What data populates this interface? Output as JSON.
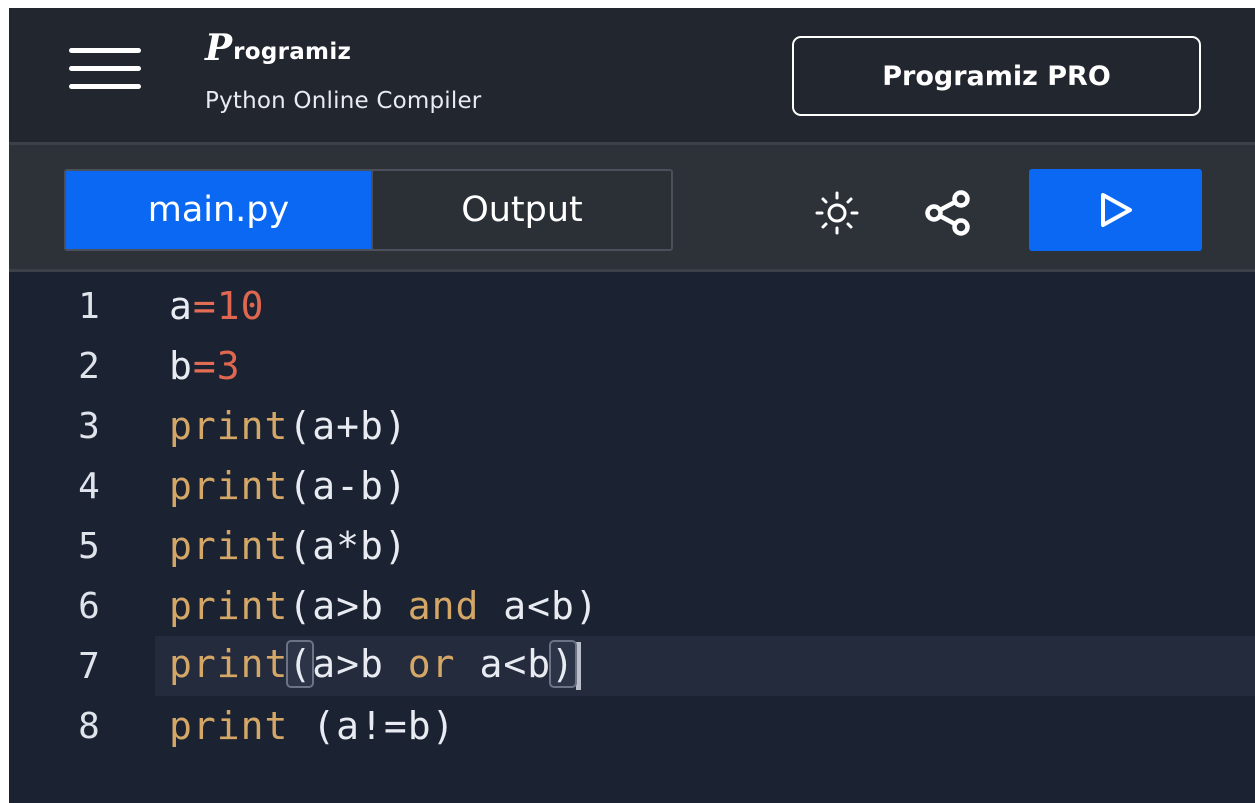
{
  "header": {
    "brand_mark": "P",
    "brand_name": "rogramiz",
    "subtitle": "Python Online Compiler",
    "pro_button_label": "Programiz PRO",
    "menu_icon": "hamburger-menu-icon"
  },
  "toolbar": {
    "tabs": [
      {
        "label": "main.py",
        "active": true
      },
      {
        "label": "Output",
        "active": false
      }
    ],
    "theme_icon": "sun-icon",
    "share_icon": "share-icon",
    "run_icon": "play-icon"
  },
  "editor": {
    "current_line": 7,
    "lines": [
      {
        "number": "1",
        "tokens": [
          "a",
          "=",
          "10"
        ]
      },
      {
        "number": "2",
        "tokens": [
          "b",
          "=",
          "3"
        ]
      },
      {
        "number": "3",
        "tokens": [
          "print",
          "(a+b)"
        ]
      },
      {
        "number": "4",
        "tokens": [
          "print",
          "(a-b)"
        ]
      },
      {
        "number": "5",
        "tokens": [
          "print",
          "(a*b)"
        ]
      },
      {
        "number": "6",
        "tokens": [
          "print",
          "(a>b ",
          "and",
          " a<b)"
        ]
      },
      {
        "number": "7",
        "tokens": [
          "print",
          "(",
          "a>b ",
          "or",
          " a<b",
          ")"
        ]
      },
      {
        "number": "8",
        "tokens": [
          "print",
          " (a!=b)"
        ]
      }
    ]
  },
  "colors": {
    "accent_blue": "#0b68f2",
    "header_bg": "#22262f",
    "toolbar_bg": "#2d3138",
    "editor_bg": "#1b2232",
    "keyword": "#d4a766",
    "number": "#e0674f"
  }
}
